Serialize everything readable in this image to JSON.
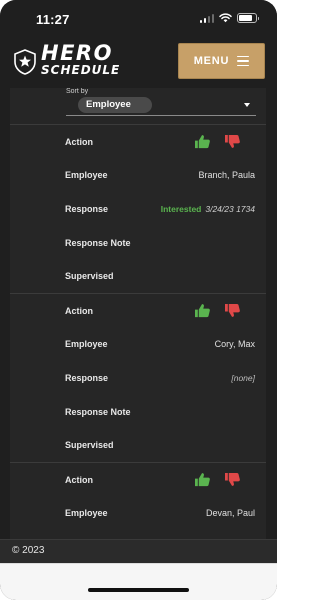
{
  "status_bar": {
    "time": "11:27",
    "battery_level": 0.8,
    "icons": [
      "signal-icon",
      "wifi-icon",
      "battery-icon"
    ]
  },
  "header": {
    "logo_top": "HERO",
    "logo_bottom": "SCHEDULE",
    "menu_label": "MENU"
  },
  "sort": {
    "label": "Sort by",
    "selected": "Employee"
  },
  "records": [
    {
      "rows": [
        {
          "label": "Action",
          "value": ""
        },
        {
          "label": "Employee",
          "value": "Branch, Paula"
        },
        {
          "label": "Response",
          "status": "Interested",
          "date": "3/24/23 1734"
        },
        {
          "label": "Response Note",
          "value": ""
        },
        {
          "label": "Supervised",
          "value": ""
        }
      ]
    },
    {
      "rows": [
        {
          "label": "Action",
          "value": ""
        },
        {
          "label": "Employee",
          "value": "Cory, Max"
        },
        {
          "label": "Response",
          "value": "[none]"
        },
        {
          "label": "Response Note",
          "value": ""
        },
        {
          "label": "Supervised",
          "value": ""
        }
      ]
    },
    {
      "rows": [
        {
          "label": "Action",
          "value": ""
        },
        {
          "label": "Employee",
          "value": "Devan, Paul"
        }
      ]
    }
  ],
  "footer": {
    "copyright": "© 2023"
  },
  "colors": {
    "accent_gold": "#c7a068",
    "approve_green": "#5ab44f",
    "deny_red": "#e04848",
    "background": "#1f1f1f"
  }
}
